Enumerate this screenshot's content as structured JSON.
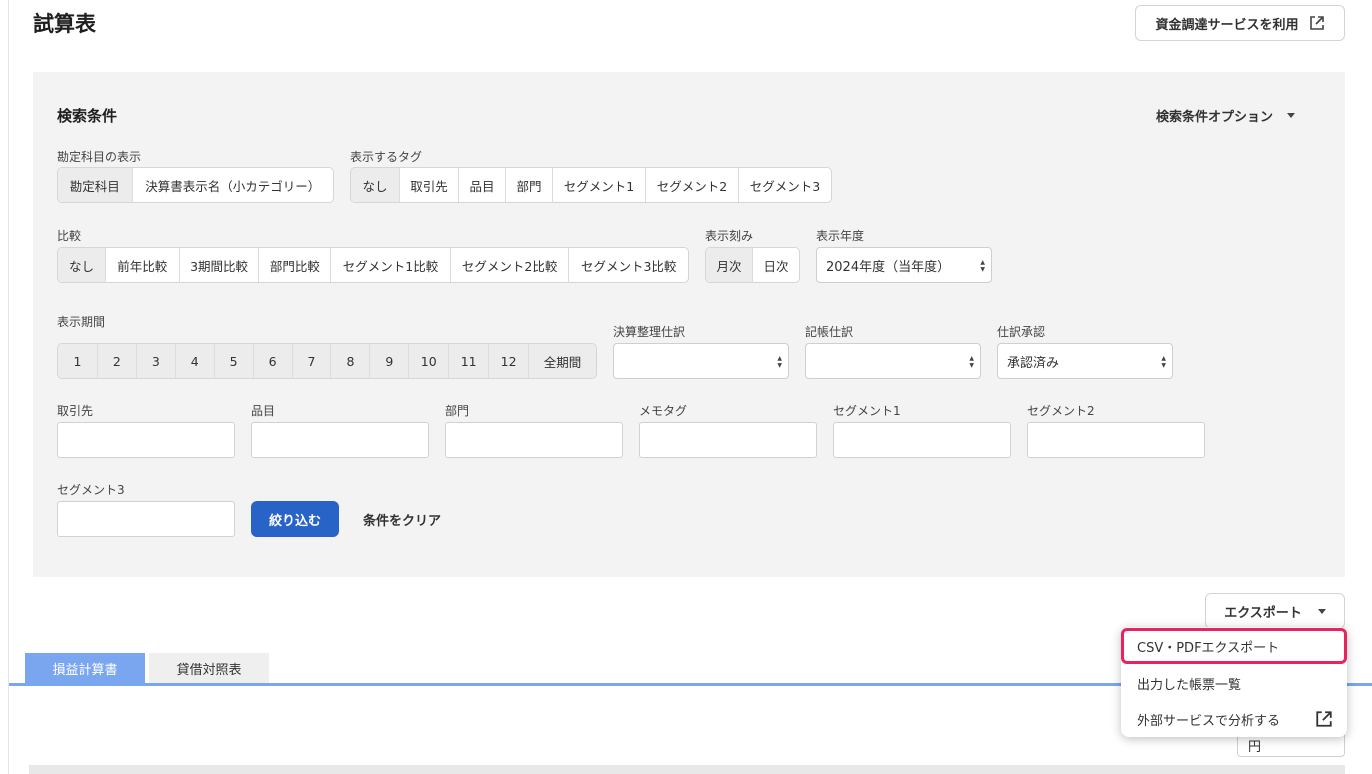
{
  "header": {
    "title": "試算表",
    "fund_button_label": "資金調達サービスを利用"
  },
  "search": {
    "title": "検索条件",
    "options_label": "検索条件オプション",
    "account_display": {
      "label": "勘定科目の表示",
      "options": [
        "勘定科目",
        "決算書表示名（小カテゴリー）"
      ],
      "selected": "勘定科目"
    },
    "tags": {
      "label": "表示するタグ",
      "options": [
        "なし",
        "取引先",
        "品目",
        "部門",
        "セグメント1",
        "セグメント2",
        "セグメント3"
      ],
      "selected": "なし"
    },
    "compare": {
      "label": "比較",
      "options": [
        "なし",
        "前年比較",
        "3期間比較",
        "部門比較",
        "セグメント1比較",
        "セグメント2比較",
        "セグメント3比較"
      ],
      "selected": "なし"
    },
    "granularity": {
      "label": "表示刻み",
      "options": [
        "月次",
        "日次"
      ],
      "selected": "月次"
    },
    "fiscal_year": {
      "label": "表示年度",
      "value": "2024年度（当年度）"
    },
    "period": {
      "label": "表示期間",
      "options": [
        "1",
        "2",
        "3",
        "4",
        "5",
        "6",
        "7",
        "8",
        "9",
        "10",
        "11",
        "12",
        "全期間"
      ]
    },
    "closing_entries": {
      "label": "決算整理仕訳",
      "value": ""
    },
    "book_entries": {
      "label": "記帳仕訳",
      "value": ""
    },
    "approval": {
      "label": "仕訳承認",
      "value": "承認済み"
    },
    "filters": {
      "partner": "取引先",
      "item": "品目",
      "department": "部門",
      "memo_tag": "メモタグ",
      "segment1": "セグメント1",
      "segment2": "セグメント2",
      "segment3": "セグメント3"
    },
    "apply_label": "絞り込む",
    "clear_label": "条件をクリア"
  },
  "export": {
    "label": "エクスポート",
    "menu": [
      {
        "label": "CSV・PDFエクスポート"
      },
      {
        "label": "出力した帳票一覧"
      },
      {
        "label": "外部サービスで分析する"
      }
    ]
  },
  "tabs": [
    "損益計算書",
    "貸借対照表"
  ],
  "unit_select": {
    "value": "円"
  },
  "colors": {
    "primary": "#2864c8",
    "tab_active": "#7aa6f0",
    "highlight": "#e8245e"
  }
}
